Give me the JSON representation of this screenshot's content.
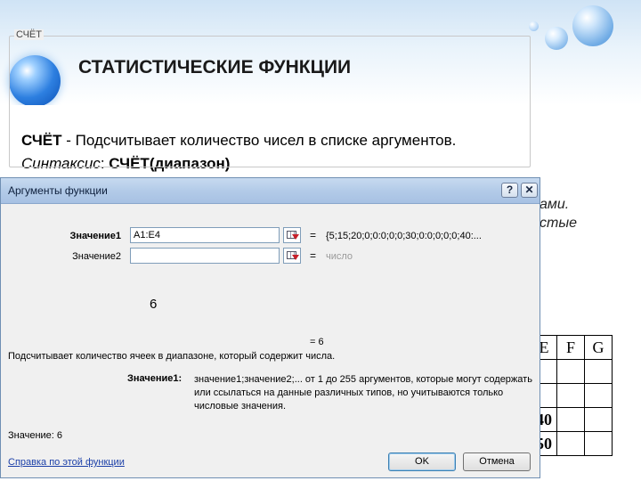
{
  "slide": {
    "title": "СТАТИСТИЧЕСКИЕ ФУНКЦИИ",
    "line1_func": "СЧЁТ",
    "line1_text": " - Подсчитывает количество чисел в списке аргументов.",
    "line2_label": "Синтаксис",
    "line2_colon": ": ",
    "line2_syntax": "СЧЁТ(диапазон)",
    "background_fragment_1": "ами.",
    "background_fragment_2": "стые"
  },
  "sheet_fragment": {
    "columns": [
      "E",
      "F",
      "G"
    ],
    "values": [
      "40",
      "50"
    ]
  },
  "dialog": {
    "title": "Аргументы функции",
    "help_button": "?",
    "close_button": "✕",
    "function_name": "СЧЁТ",
    "args": [
      {
        "label": "Значение1",
        "value": "A1:E4",
        "equals": "=",
        "result": "{5;15;20;0;0:0;0;0;30;0:0;0;0;0;40:..."
      },
      {
        "label": "Значение2",
        "value": "",
        "equals": "=",
        "result": "число"
      }
    ],
    "result_big": "6",
    "total": "= 6",
    "description": "Подсчитывает количество ячеек в диапазоне, который содержит числа.",
    "hint_label": "Значение1:",
    "hint_text": "значение1;значение2;... от 1 до 255 аргументов, которые могут содержать или ссылаться на данные различных типов, но учитываются только числовые значения.",
    "value_line": "Значение:  6",
    "help_link": "Справка по этой функции",
    "ok_label": "OK",
    "cancel_label": "Отмена"
  }
}
